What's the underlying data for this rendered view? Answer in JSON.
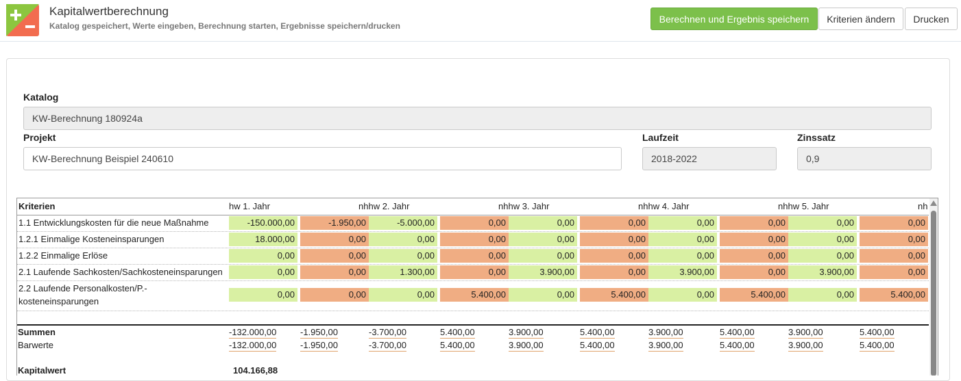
{
  "header": {
    "title": "Kapitalwertberechnung",
    "subtitle": "Katalog gespeichert, Werte eingeben, Berechnung starten, Ergebnisse speichern/drucken",
    "buttons": {
      "calculate": "Berechnen und Ergebnis speichern",
      "criteria": "Kriterien ändern",
      "print": "Drucken"
    },
    "logo_colors": {
      "top": "#8cc63f",
      "bottom": "#f26c4f"
    }
  },
  "form": {
    "catalog_label": "Katalog",
    "catalog_value": "KW-Berechnung 180924a",
    "project_label": "Projekt",
    "project_value": "KW-Berechnung Beispiel 240610",
    "runtime_label": "Laufzeit",
    "runtime_value": "2018-2022",
    "rate_label": "Zinssatz",
    "rate_value": "0,9"
  },
  "table": {
    "criteria_header": "Kriterien",
    "year_headers": [
      "hw 1. Jahr",
      "nhhw 2. Jahr",
      "nhhw 3. Jahr",
      "nhhw 4. Jahr",
      "nhhw 5. Jahr",
      "nh"
    ],
    "colors": {
      "green": "#d9f0a3",
      "orange": "#f0ad83"
    },
    "rows": [
      {
        "label": "1.1 Entwicklungskosten für die neue Maßnahme",
        "values": [
          "-150.000,00",
          "-1.950,00",
          "-5.000,00",
          "0,00",
          "0,00",
          "0,00",
          "0,00",
          "0,00",
          "0,00",
          "0,00"
        ]
      },
      {
        "label": "1.2.1 Einmalige Kosteneinsparungen",
        "values": [
          "18.000,00",
          "0,00",
          "0,00",
          "0,00",
          "0,00",
          "0,00",
          "0,00",
          "0,00",
          "0,00",
          "0,00"
        ]
      },
      {
        "label": "1.2.2 Einmalige Erlöse",
        "values": [
          "0,00",
          "0,00",
          "0,00",
          "0,00",
          "0,00",
          "0,00",
          "0,00",
          "0,00",
          "0,00",
          "0,00"
        ]
      },
      {
        "label": "2.1 Laufende Sachkosten/Sachkosteneinsparungen",
        "values": [
          "0,00",
          "0,00",
          "1.300,00",
          "0,00",
          "3.900,00",
          "0,00",
          "3.900,00",
          "0,00",
          "3.900,00",
          "0,00"
        ]
      },
      {
        "label_line1": "2.2 Laufende Personalkosten/P.-",
        "label_line2": "kosteneinsparungen",
        "values": [
          "0,00",
          "0,00",
          "0,00",
          "5.400,00",
          "0,00",
          "5.400,00",
          "0,00",
          "5.400,00",
          "0,00",
          "5.400,00"
        ]
      }
    ],
    "sums_label": "Summen",
    "sums": [
      "-132.000,00",
      "-1.950,00",
      "-3.700,00",
      "5.400,00",
      "3.900,00",
      "5.400,00",
      "3.900,00",
      "5.400,00",
      "3.900,00",
      "5.400,00"
    ],
    "present_label": "Barwerte",
    "present_values": [
      "-132.000,00",
      "-1.950,00",
      "-3.700,00",
      "5.400,00",
      "3.900,00",
      "5.400,00",
      "3.900,00",
      "5.400,00",
      "3.900,00",
      "5.400,00"
    ],
    "npv_label": "Kapitalwert",
    "npv_value": "104.166,88"
  }
}
